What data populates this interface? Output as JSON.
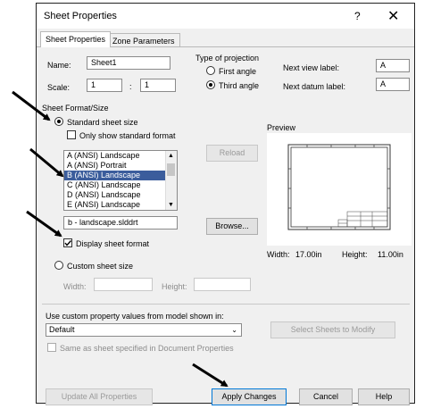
{
  "window": {
    "title": "Sheet Properties",
    "help": "?",
    "close": "✕"
  },
  "tabs": [
    {
      "label": "Sheet Properties"
    },
    {
      "label": "Zone Parameters"
    }
  ],
  "fields": {
    "name_label": "Name:",
    "name_value": "Sheet1",
    "scale_label": "Scale:",
    "scale_num": "1",
    "scale_sep": ":",
    "scale_den": "1",
    "projection_label": "Type of projection",
    "first_angle": "First angle",
    "third_angle": "Third angle",
    "next_view_label": "Next view label:",
    "next_view_value": "A",
    "next_datum_label": "Next datum label:",
    "next_datum_value": "A"
  },
  "format": {
    "group_label": "Sheet Format/Size",
    "standard_size": "Standard sheet size",
    "only_standard": "Only show standard format",
    "sizes": [
      "A (ANSI) Landscape",
      "A (ANSI) Portrait",
      "B (ANSI) Landscape",
      "C (ANSI) Landscape",
      "D (ANSI) Landscape",
      "E (ANSI) Landscape"
    ],
    "selected_index": 2,
    "reload": "Reload",
    "file_value": "b - landscape.slddrt",
    "browse": "Browse...",
    "display_format": "Display sheet format",
    "custom_size": "Custom sheet size",
    "width_label": "Width:",
    "height_label": "Height:"
  },
  "preview": {
    "label": "Preview",
    "width_label": "Width:",
    "width_value": "17.00in",
    "height_label": "Height:",
    "height_value": "11.00in"
  },
  "model": {
    "label": "Use custom property values from model shown in:",
    "select_value": "Default",
    "select_sheets": "Select Sheets to Modify",
    "same_as": "Same as sheet specified in Document Properties"
  },
  "buttons": {
    "update": "Update All Properties",
    "apply": "Apply Changes",
    "cancel": "Cancel",
    "help": "Help"
  },
  "colors": {
    "selection": "#3b5d9c",
    "dialog_bg": "#f0f0f0"
  }
}
